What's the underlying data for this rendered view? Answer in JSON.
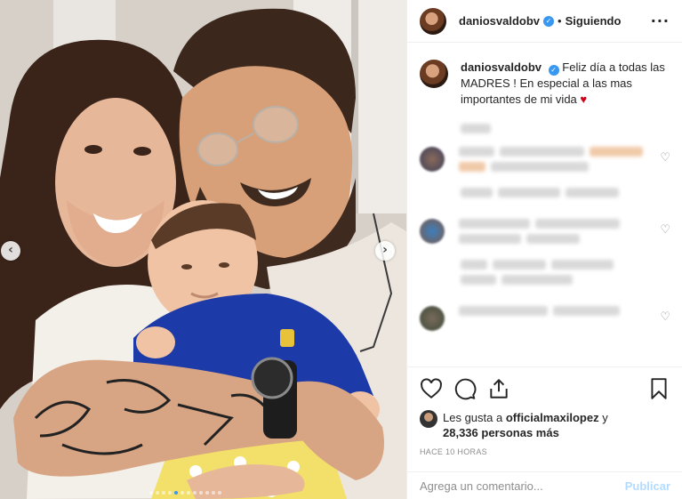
{
  "post": {
    "username": "daniosvaldobv",
    "follow_status": "Siguiendo",
    "separator": "•",
    "more_label": "···",
    "verified_mark": "✓",
    "caption": {
      "username": "daniosvaldobv",
      "text": "Feliz día a todas las MADRES ! En especial a las mas importantes de mi vida",
      "emoji": "♥"
    },
    "likes": {
      "prefix": "Les gusta a",
      "user": "officialmaxilopez",
      "suffix": "y",
      "count": "28,336 personas más"
    },
    "timestamp": "HACE 10 HORAS",
    "comment_input": {
      "placeholder": "Agrega un comentario..."
    },
    "publish_label": "Publicar"
  },
  "carousel": {
    "prev_icon": "‹",
    "next_icon": "›",
    "dot_count": 12,
    "active_dot": 4
  },
  "icons": {
    "like": "heart-icon",
    "comment": "comment-icon",
    "share": "share-icon",
    "save": "bookmark-icon",
    "comment_like": "♡"
  },
  "colors": {
    "accent": "#3897f0",
    "publish_disabled": "#b3dbff",
    "secondary_text": "#8e8e8e",
    "heart": "#d0021b"
  }
}
